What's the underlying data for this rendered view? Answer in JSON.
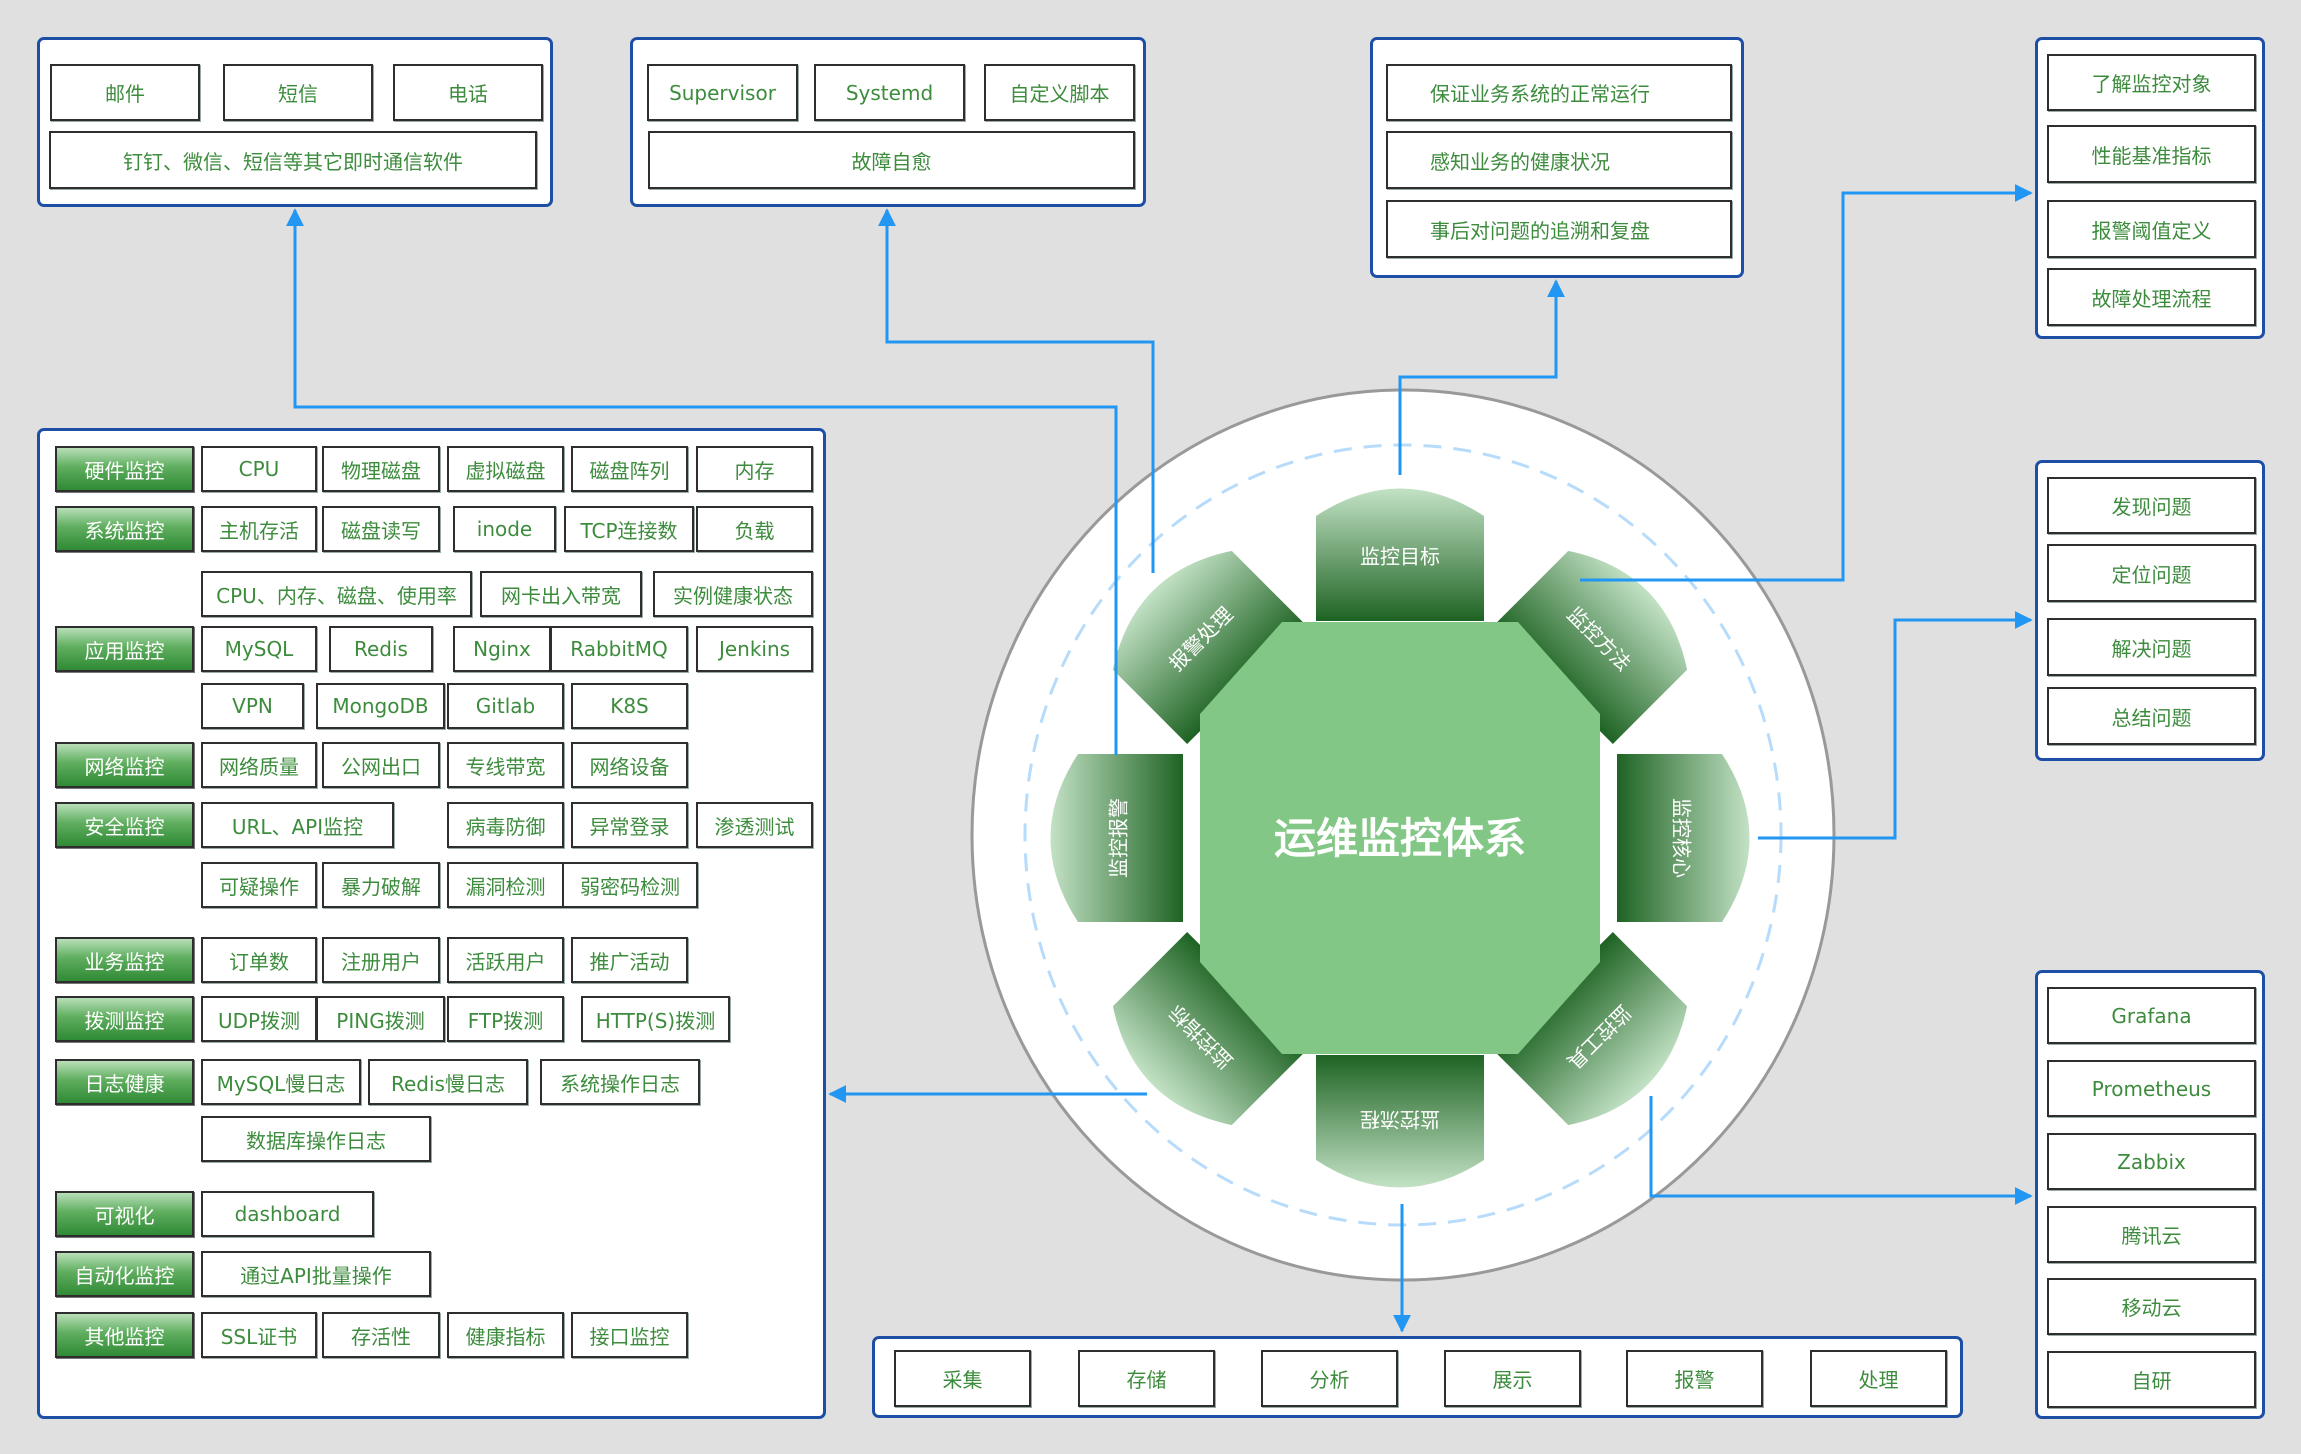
{
  "title": "运维监控体系",
  "segments": {
    "top": "监控目标",
    "top_right": "监控方法",
    "right": "监控核心",
    "bottom_right": "监控工具",
    "bottom": "监控流程",
    "bottom_left": "监控指标",
    "left": "监控报警",
    "top_left": "报警处理"
  },
  "notification_panel": {
    "items": [
      "邮件",
      "短信",
      "电话"
    ],
    "wide_item": "钉钉、微信、短信等其它即时通信软件"
  },
  "self_heal_panel": {
    "items": [
      "Supervisor",
      "Systemd",
      "自定义脚本"
    ],
    "wide_item": "故障自愈"
  },
  "goals_panel": {
    "items": [
      "保证业务系统的正常运行",
      "感知业务的健康状况",
      "事后对问题的追溯和复盘"
    ]
  },
  "methods_panel": {
    "items": [
      "了解监控对象",
      "性能基准指标",
      "报警阈值定义",
      "故障处理流程"
    ]
  },
  "core_panel": {
    "items": [
      "发现问题",
      "定位问题",
      "解决问题",
      "总结问题"
    ]
  },
  "tools_panel": {
    "items": [
      "Grafana",
      "Prometheus",
      "Zabbix",
      "腾讯云",
      "移动云",
      "自研"
    ]
  },
  "process_panel": {
    "items": [
      "采集",
      "存储",
      "分析",
      "展示",
      "报警",
      "处理"
    ]
  },
  "metrics_panel": {
    "categories": [
      {
        "label": "硬件监控",
        "rows": [
          [
            "CPU",
            "物理磁盘",
            "虚拟磁盘",
            "磁盘阵列",
            "内存"
          ]
        ]
      },
      {
        "label": "系统监控",
        "rows": [
          [
            "主机存活",
            "磁盘读写",
            "inode",
            "TCP连接数",
            "负载"
          ],
          [
            "CPU、内存、磁盘、使用率",
            "网卡出入带宽",
            "实例健康状态"
          ]
        ]
      },
      {
        "label": "应用监控",
        "rows": [
          [
            "MySQL",
            "Redis",
            "Nginx",
            "RabbitMQ",
            "Jenkins"
          ],
          [
            "VPN",
            "MongoDB",
            "Gitlab",
            "K8S"
          ]
        ]
      },
      {
        "label": "网络监控",
        "rows": [
          [
            "网络质量",
            "公网出口",
            "专线带宽",
            "网络设备"
          ]
        ]
      },
      {
        "label": "安全监控",
        "rows": [
          [
            "URL、API监控",
            "病毒防御",
            "异常登录",
            "渗透测试"
          ],
          [
            "可疑操作",
            "暴力破解",
            "漏洞检测",
            "弱密码检测"
          ]
        ]
      },
      {
        "label": "业务监控",
        "rows": [
          [
            "订单数",
            "注册用户",
            "活跃用户",
            "推广活动"
          ]
        ]
      },
      {
        "label": "拨测监控",
        "rows": [
          [
            "UDP拨测",
            "PING拨测",
            "FTP拨测",
            "HTTP(S)拨测"
          ]
        ]
      },
      {
        "label": "日志健康",
        "rows": [
          [
            "MySQL慢日志",
            "Redis慢日志",
            "系统操作日志"
          ],
          [
            "数据库操作日志"
          ]
        ]
      },
      {
        "label": "可视化",
        "rows": [
          [
            "dashboard"
          ]
        ]
      },
      {
        "label": "自动化监控",
        "rows": [
          [
            "通过API批量操作"
          ]
        ]
      },
      {
        "label": "其他监控",
        "rows": [
          [
            "SSL证书",
            "存活性",
            "健康指标",
            "接口监控"
          ]
        ]
      }
    ]
  },
  "colors": {
    "background": "#e0e0e0",
    "panel_border": "#1d4fa6",
    "connector": "#2196f3",
    "item_text": "#3d8c3d",
    "octagon": "#82c785",
    "segment_dark": "#1e6323",
    "segment_light": "#c3e2c5"
  }
}
